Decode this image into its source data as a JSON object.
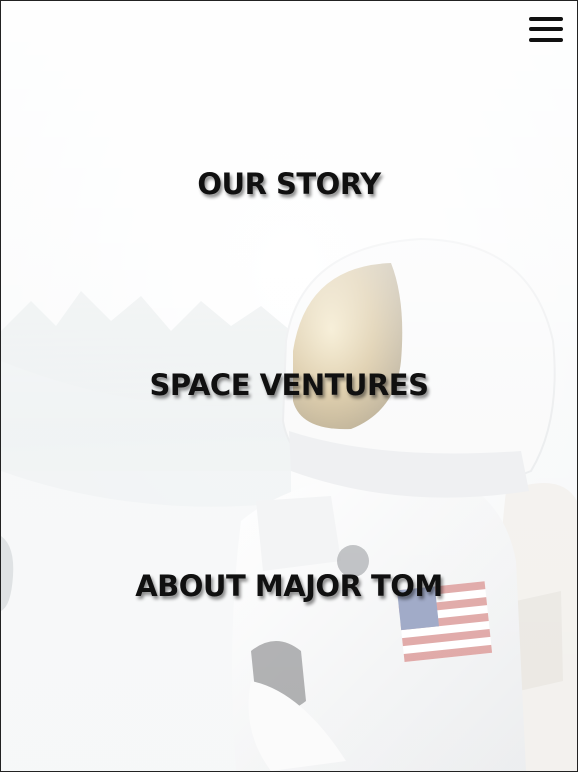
{
  "menu": {
    "icon": "hamburger-menu-icon"
  },
  "nav": {
    "items": [
      {
        "label": "OUR STORY"
      },
      {
        "label": "SPACE VENTURES"
      },
      {
        "label": "ABOUT MAJOR TOM"
      }
    ]
  },
  "background": {
    "subject": "astronaut-photo",
    "colors": {
      "page": "#f4f5f6",
      "text": "#101010",
      "visor_gold": "#b08a3a",
      "flag_red": "#c0504d",
      "flag_blue": "#3a4f8c"
    }
  }
}
